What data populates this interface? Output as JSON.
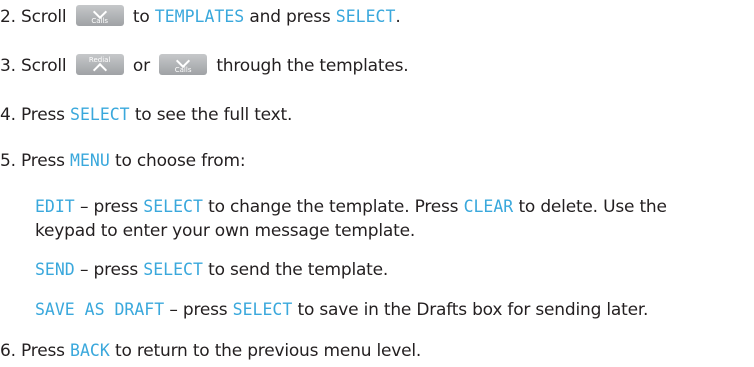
{
  "steps": [
    {
      "num": "2.",
      "t1": "Scroll",
      "key": {
        "label": "Calls",
        "icon": "chevron-down-icon"
      },
      "t2": "to",
      "kw1": "TEMPLATES",
      "t3": "and press",
      "kw2": "SELECT",
      "t4": "."
    },
    {
      "num": "3.",
      "t1": "Scroll",
      "key1": {
        "label": "Redial",
        "icon": "chevron-up-icon"
      },
      "t2": "or",
      "key2": {
        "label": "Calls",
        "icon": "chevron-down-icon"
      },
      "t3": "through the templates."
    },
    {
      "num": "4.",
      "t1": "Press",
      "kw1": "SELECT",
      "t2": "to see the full text."
    },
    {
      "num": "5.",
      "t1": "Press",
      "kw1": "MENU",
      "t2": "to choose from:"
    },
    {
      "num": "6.",
      "t1": "Press",
      "kw1": "BACK",
      "t2": "to return to the previous menu level."
    }
  ],
  "options": {
    "edit": {
      "kw1": "EDIT",
      "t1": "– press",
      "kw2": "SELECT",
      "t2": "to change the template. Press",
      "kw3": "CLEAR",
      "t3": "to delete. Use the",
      "line2": "keypad to enter your own message template."
    },
    "send": {
      "kw1": "SEND",
      "t1": "– press",
      "kw2": "SELECT",
      "t2": "to send the template."
    },
    "save": {
      "kw1": "SAVE AS DRAFT",
      "t1": "– press",
      "kw2": "SELECT",
      "t2": "to save in the Drafts box for sending later."
    }
  },
  "colors": {
    "keyword": "#3aa8dc",
    "text": "#231f20",
    "key_button": "#b3b5b8"
  }
}
